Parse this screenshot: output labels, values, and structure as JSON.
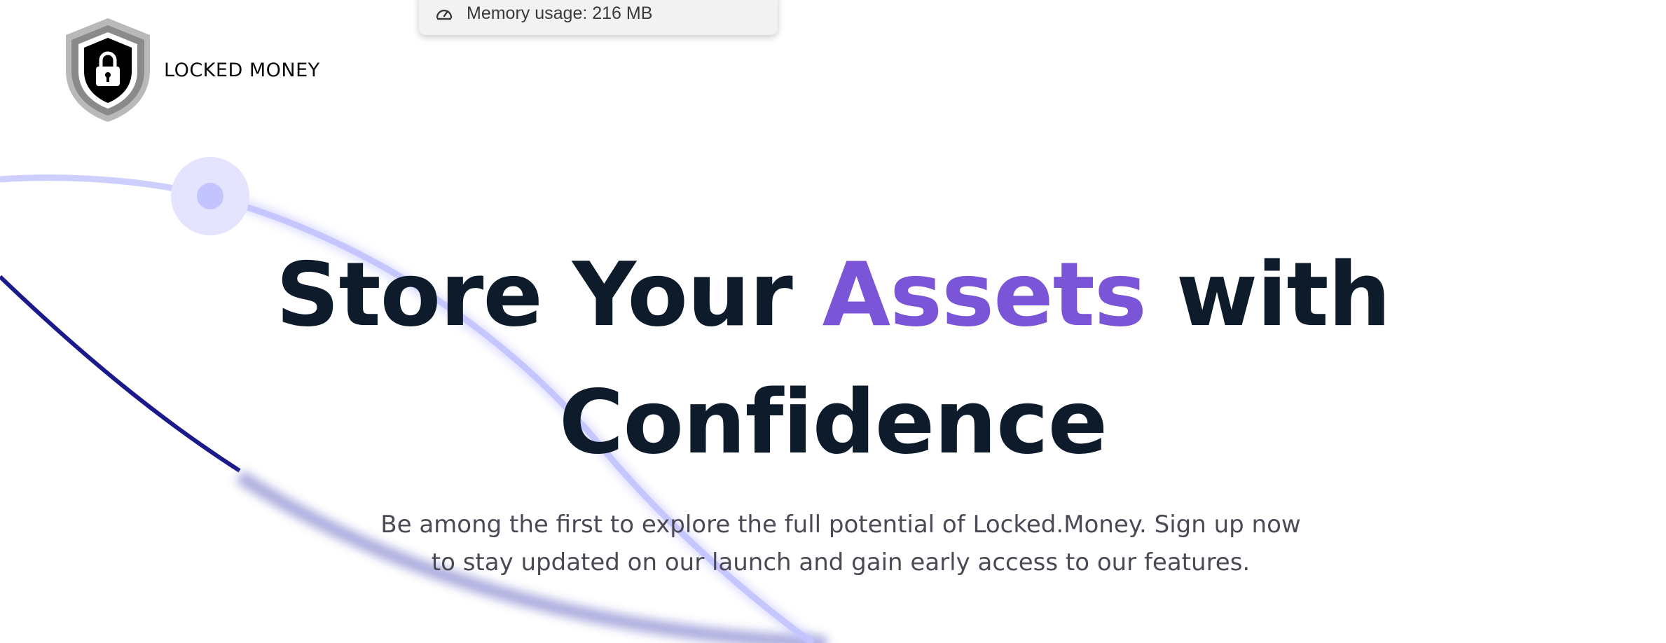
{
  "tooltip": {
    "text": "Memory usage: 216 MB",
    "icon": "gauge-icon"
  },
  "logo": {
    "brand": "LOCKED MONEY",
    "icon": "shield-lock-icon"
  },
  "hero": {
    "headline_part1": "Store Your",
    "headline_accent": "Assets",
    "headline_part2": "with",
    "headline_line2": "Confidence",
    "subtitle": "Be among the first to explore the full potential of Locked.Money. Sign up now to stay updated on our launch and gain early access to our features."
  },
  "colors": {
    "headline": "#0d1b2a",
    "accent": "#7b55d8",
    "subtitle": "#4a4a54",
    "navy_curve": "#1a1a8a",
    "lavender_curve": "#c4c4ff"
  }
}
